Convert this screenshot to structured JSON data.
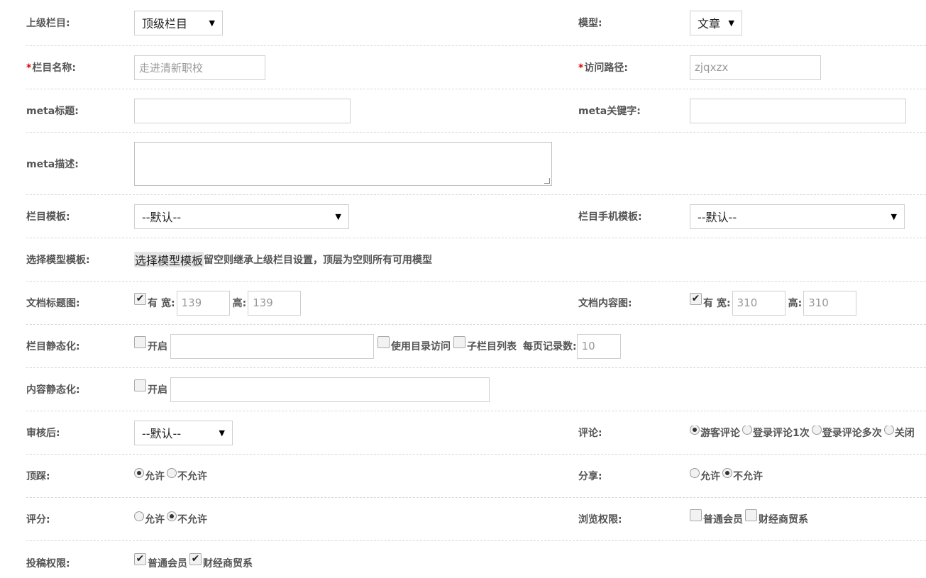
{
  "rows": {
    "parent": {
      "label": "上级栏目:",
      "value": "顶级栏目"
    },
    "model": {
      "label": "模型:",
      "value": "文章"
    },
    "name": {
      "required": "*",
      "label": "栏目名称:",
      "placeholder": "走进清新职校"
    },
    "path": {
      "required": "*",
      "label": "访问路径:",
      "placeholder": "zjqxzx"
    },
    "meta_title": {
      "label": "meta标题:",
      "value": ""
    },
    "meta_keywords": {
      "label": "meta关键字:",
      "value": ""
    },
    "meta_desc": {
      "label": "meta描述:",
      "value": ""
    },
    "template": {
      "label": "栏目模板:",
      "value": "--默认--"
    },
    "mobile_template": {
      "label": "栏目手机模板:",
      "value": "--默认--"
    },
    "model_template": {
      "label": "选择模型模板:",
      "button": "选择模型模板",
      "hint": "留空则继承上级栏目设置，顶层为空则所有可用模型"
    },
    "doc_title_img": {
      "label": "文档标题图:",
      "checkbox": "有",
      "width_label": "宽:",
      "width": "139",
      "height_label": "高:",
      "height": "139"
    },
    "doc_content_img": {
      "label": "文档内容图:",
      "checkbox": "有",
      "width_label": "宽:",
      "width": "310",
      "height_label": "高:",
      "height": "310"
    },
    "static": {
      "label": "栏目静态化:",
      "checkbox": "开启",
      "value": "",
      "dir_access": "使用目录访问",
      "sub_list": "子栏目列表",
      "per_page_label": "每页记录数:",
      "per_page": "10"
    },
    "content_static": {
      "label": "内容静态化:",
      "checkbox": "开启",
      "value": ""
    },
    "audit": {
      "label": "审核后:",
      "value": "--默认--"
    },
    "comment": {
      "label": "评论:",
      "options": [
        "游客评论",
        "登录评论1次",
        "登录评论多次",
        "关闭"
      ],
      "selected": 0
    },
    "vote": {
      "label": "顶踩:",
      "options": [
        "允许",
        "不允许"
      ],
      "selected": 0
    },
    "share": {
      "label": "分享:",
      "options": [
        "允许",
        "不允许"
      ],
      "selected": 1
    },
    "rating": {
      "label": "评分:",
      "options": [
        "允许",
        "不允许"
      ],
      "selected": 1
    },
    "browse": {
      "label": "浏览权限:",
      "options": [
        "普通会员",
        "财经商贸系"
      ],
      "checked": [
        false,
        false
      ]
    },
    "submit": {
      "label": "投稿权限:",
      "options": [
        "普通会员",
        "财经商贸系"
      ],
      "checked": [
        true,
        true
      ]
    }
  },
  "icons": {
    "select_arrow": "triangle-down-icon",
    "check": "check-icon"
  }
}
